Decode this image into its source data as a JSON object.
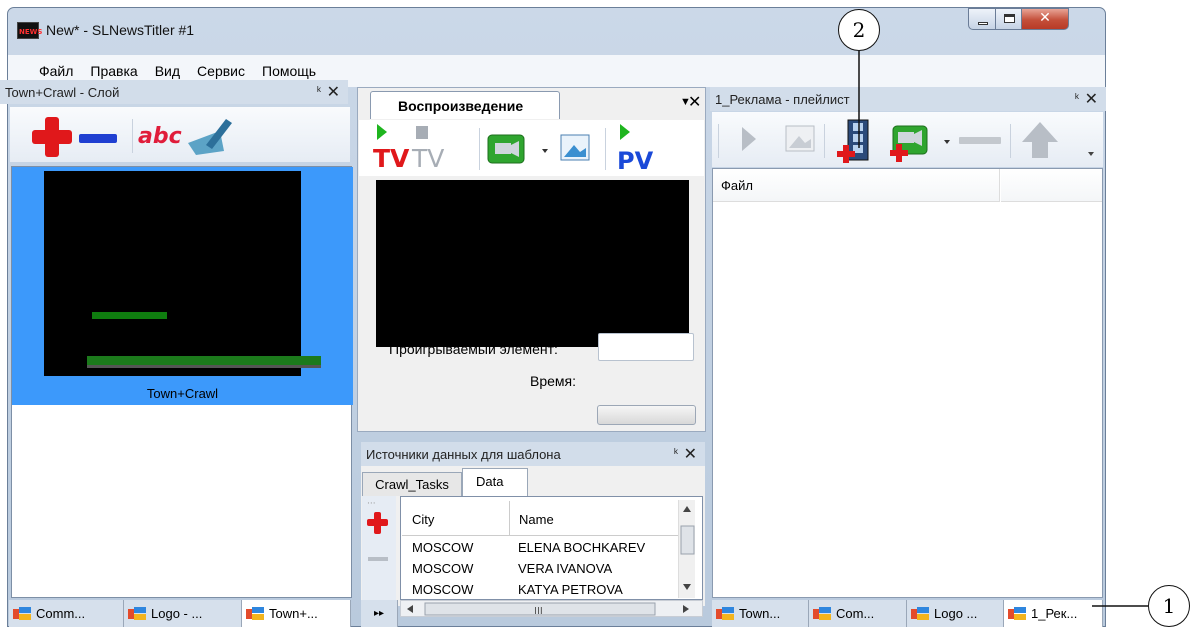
{
  "window": {
    "title": "New* - SLNewsTitler #1",
    "app_icon_text": "NEWS"
  },
  "menu": [
    "Файл",
    "Правка",
    "Вид",
    "Сервис",
    "Помощь"
  ],
  "left_panel": {
    "title": "Town+Crawl - Слой",
    "toolbar_text": "abc",
    "layer_label": "Town+Crawl"
  },
  "playback_panel": {
    "tab_label": "Воспроизведение",
    "toolbar": {
      "tv1": "TV",
      "tv2": "TV",
      "pv": "PV"
    },
    "playing_element_label": "Проигрываемый элемент:",
    "playing_element_value": "",
    "time_label": "Время:"
  },
  "datasource_panel": {
    "title": "Источники данных для шаблона",
    "tabs": [
      "Crawl_Tasks",
      "Data"
    ],
    "active_tab": "Data",
    "columns": [
      "City",
      "Name"
    ],
    "rows": [
      [
        "MOSCOW",
        "ELENA BOCHKAREV"
      ],
      [
        "MOSCOW",
        "VERA IVANOVA"
      ],
      [
        "MOSCOW",
        "KATYA PETROVA"
      ]
    ],
    "hscroll_mark": "III"
  },
  "playlist_panel": {
    "title": "1_Реклама - плейлист",
    "column_file": "Файл"
  },
  "bottom_tabs_left": [
    {
      "label": "Comm...",
      "active": false
    },
    {
      "label": "Logo - ...",
      "active": false
    },
    {
      "label": "Town+...",
      "active": true
    }
  ],
  "bottom_tabs_right": [
    {
      "label": "Town...",
      "active": false
    },
    {
      "label": "Com...",
      "active": false
    },
    {
      "label": "Logo ...",
      "active": false
    },
    {
      "label": "1_Рек...",
      "active": true
    }
  ],
  "callouts": [
    "1",
    "2"
  ],
  "icons": {
    "window": [
      "app-icon",
      "minimize-icon",
      "maximize-icon",
      "close-icon"
    ],
    "left_toolbar": [
      "add-layer-icon",
      "remove-layer-icon",
      "rename-icon",
      "edit-icon"
    ],
    "playback_toolbar": [
      "play-to-tv-icon",
      "stop-tv-icon",
      "camera-icon",
      "dropdown-icon",
      "image-icon",
      "preview-icon"
    ],
    "playlist_toolbar": [
      "play-icon",
      "image-icon",
      "add-video-icon",
      "add-camera-icon",
      "dropdown-icon",
      "remove-icon",
      "move-up-icon",
      "more-icon"
    ]
  },
  "colors": {
    "accent_blue": "#3c99fb",
    "green": "#1c7a1c",
    "red": "#e0181b"
  }
}
